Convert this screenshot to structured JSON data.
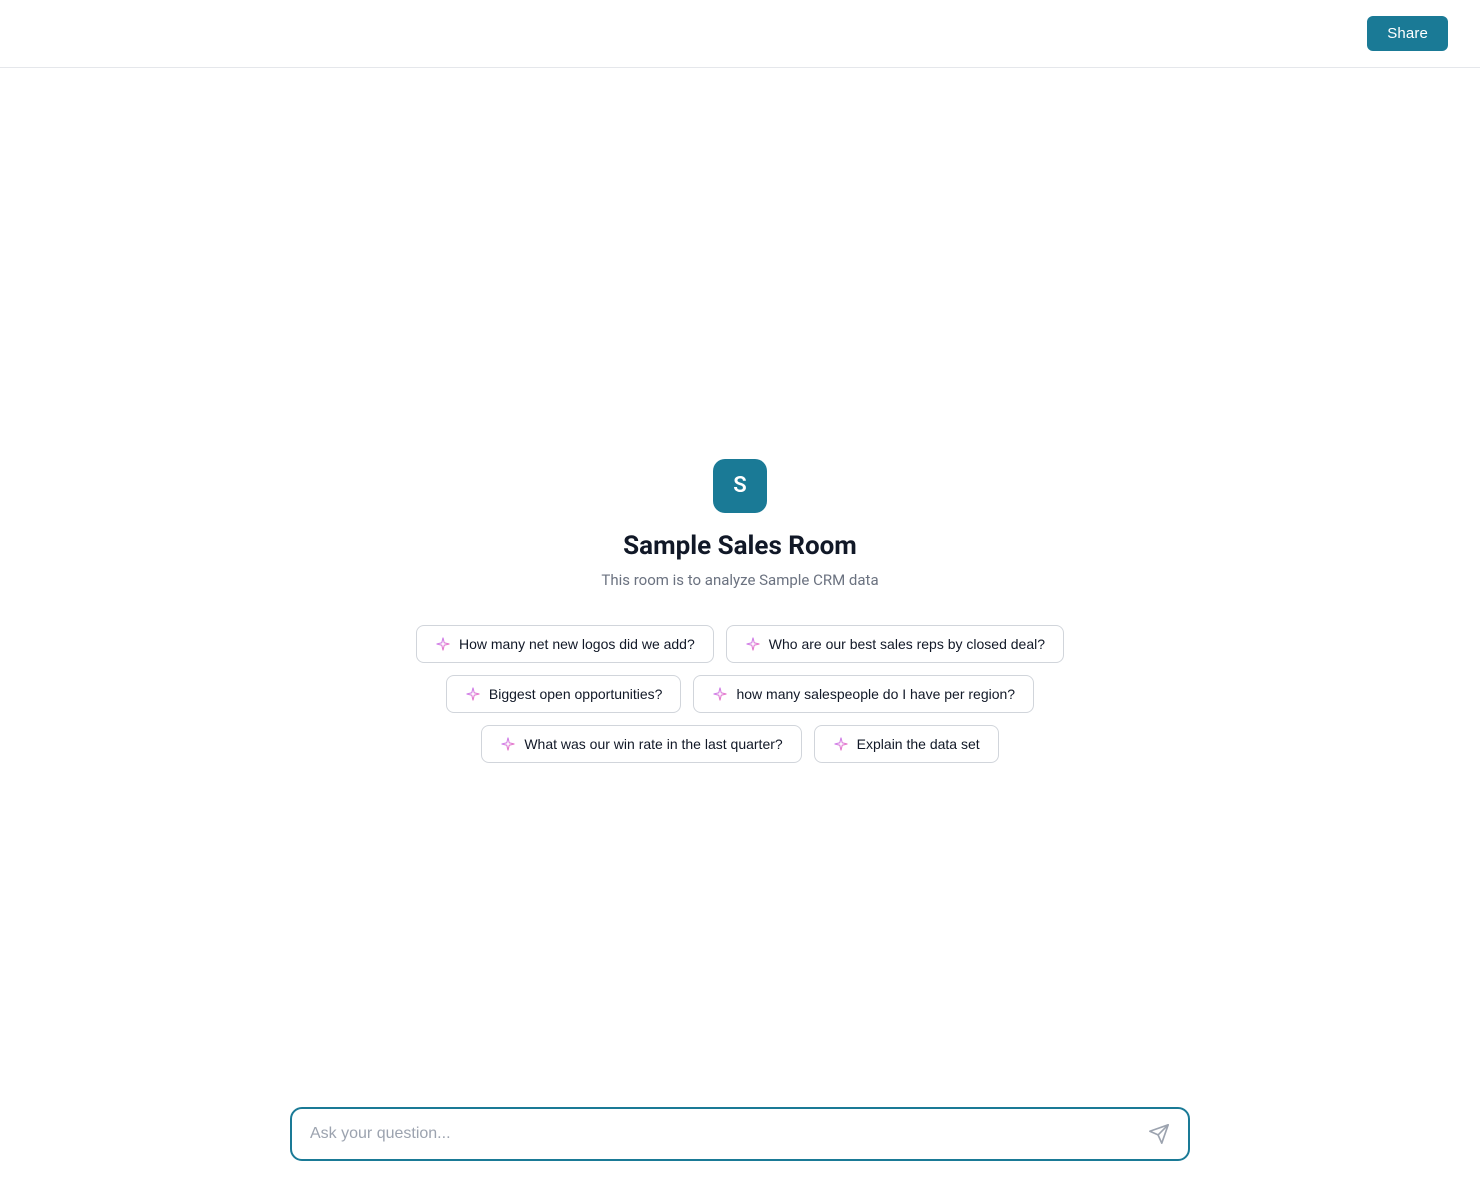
{
  "header": {
    "share_label": "Share"
  },
  "room": {
    "icon_letter": "S",
    "title": "Sample Sales Room",
    "subtitle": "This room is to analyze Sample CRM data"
  },
  "suggestions": {
    "rows": [
      [
        {
          "id": "s1",
          "label": "How many net new logos did we add?"
        },
        {
          "id": "s2",
          "label": "Who are our best sales reps by closed deal?"
        }
      ],
      [
        {
          "id": "s3",
          "label": "Biggest open opportunities?"
        },
        {
          "id": "s4",
          "label": "how many salespeople do I have per region?"
        }
      ],
      [
        {
          "id": "s5",
          "label": "What was our win rate in the last quarter?"
        },
        {
          "id": "s6",
          "label": "Explain the data set"
        }
      ]
    ]
  },
  "input": {
    "placeholder": "Ask your question..."
  },
  "colors": {
    "accent": "#1a7a96"
  }
}
